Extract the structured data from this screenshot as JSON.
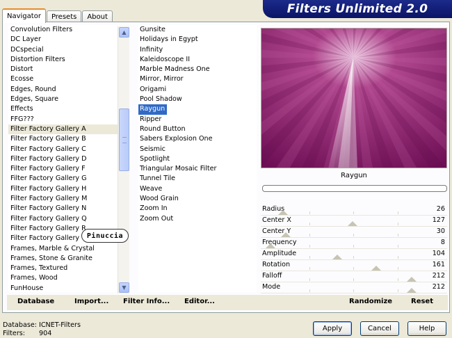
{
  "app_title": "Filters Unlimited 2.0",
  "tabs": [
    "Navigator",
    "Presets",
    "About"
  ],
  "categories": [
    "Convolution Filters",
    "DC Layer",
    "DCspecial",
    "Distortion Filters",
    "Distort",
    "Ecosse",
    "Edges, Round",
    "Edges, Square",
    "Effects",
    "FFG???",
    "Filter Factory Gallery A",
    "Filter Factory Gallery B",
    "Filter Factory Gallery C",
    "Filter Factory Gallery D",
    "Filter Factory Gallery F",
    "Filter Factory Gallery G",
    "Filter Factory Gallery H",
    "Filter Factory Gallery M",
    "Filter Factory Gallery N",
    "Filter Factory Gallery Q",
    "Filter Factory Gallery R",
    "Filter Factory Gallery V",
    "Frames, Marble & Crystal",
    "Frames, Stone & Granite",
    "Frames, Textured",
    "Frames, Wood",
    "FunHouse"
  ],
  "selected_category": "Filter Factory Gallery A",
  "filters": [
    "Gunsite",
    "Holidays in Egypt",
    "Infinity",
    "Kaleidoscope II",
    "Marble Madness One",
    "Mirror, Mirror",
    "Origami",
    "Pool Shadow",
    "Raygun",
    "Ripper",
    "Round Button",
    "Sabers Explosion One",
    "Seismic",
    "Spotlight",
    "Triangular Mosaic Filter",
    "Tunnel Tile",
    "Weave",
    "Wood Grain",
    "Zoom In",
    "Zoom Out"
  ],
  "selected_filter": "Raygun",
  "watermark": "Pinuccia",
  "preview_filter_name": "Raygun",
  "params": [
    {
      "name": "Radius",
      "value": "26",
      "slider_fraction": 0.102
    },
    {
      "name": "Center X",
      "value": "127",
      "slider_fraction": 0.498
    },
    {
      "name": "Center Y",
      "value": "30",
      "slider_fraction": 0.118
    },
    {
      "name": "Frequency",
      "value": "8",
      "slider_fraction": 0.031
    },
    {
      "name": "Amplitude",
      "value": "104",
      "slider_fraction": 0.408
    },
    {
      "name": "Rotation",
      "value": "161",
      "slider_fraction": 0.631
    },
    {
      "name": "Falloff",
      "value": "212",
      "slider_fraction": 0.831
    },
    {
      "name": "Mode",
      "value": "212",
      "slider_fraction": 0.831
    }
  ],
  "bottom_buttons": {
    "database": "Database",
    "import": "Import...",
    "filter_info": "Filter Info...",
    "editor": "Editor...",
    "randomize": "Randomize",
    "reset": "Reset"
  },
  "info": {
    "database_label": "Database:",
    "database_value": "ICNET-Filters",
    "filters_label": "Filters:",
    "filters_value": "904"
  },
  "dialog_buttons": {
    "apply": "Apply",
    "cancel": "Cancel",
    "help": "Help"
  },
  "colors": {
    "selection": "#316ac5",
    "preview_bg": "#8c1a6b",
    "banner": "#0a1466"
  }
}
